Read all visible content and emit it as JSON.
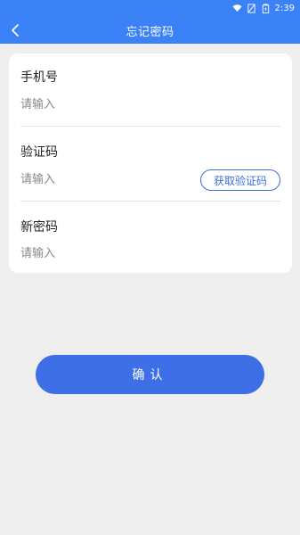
{
  "status_bar": {
    "time": "2:39",
    "icons": [
      "wifi-icon",
      "no-signal-icon",
      "battery-icon"
    ]
  },
  "app_bar": {
    "title": "忘记密码",
    "back_icon": "chevron-left-icon"
  },
  "form": {
    "phone": {
      "label": "手机号",
      "placeholder": "请输入",
      "value": ""
    },
    "code": {
      "label": "验证码",
      "placeholder": "请输入",
      "value": "",
      "button_label": "获取验证码"
    },
    "new_password": {
      "label": "新密码",
      "placeholder": "请输入",
      "value": ""
    }
  },
  "confirm_label": "确认",
  "colors": {
    "primary": "#3b82f6",
    "button": "#3f6fe6",
    "background": "#efefef"
  }
}
